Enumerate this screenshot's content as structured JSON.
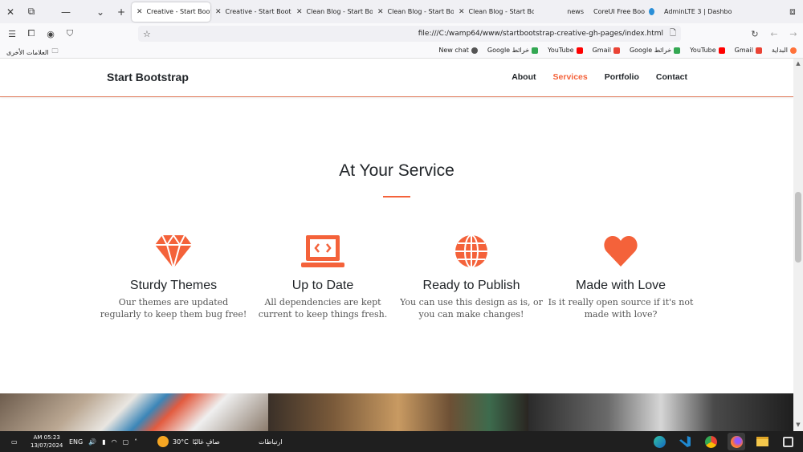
{
  "browser": {
    "tabs": [
      {
        "label": "Creative - Start Bootst",
        "active": true
      },
      {
        "label": "Creative - Start Bootst",
        "active": false
      },
      {
        "label": "Clean Blog - Start Boo",
        "active": false
      },
      {
        "label": "Clean Blog - Start Boo",
        "active": false
      },
      {
        "label": "Clean Blog - Start Boo",
        "active": false
      },
      {
        "label": "news",
        "active": false
      },
      {
        "label": "CoreUI Free Boo",
        "active": false
      },
      {
        "label": "AdminLTE 3 | Dashbo",
        "active": false
      }
    ],
    "url": "file:///C:/wamp64/www/startbootstrap-creative-gh-pages/index.html",
    "bookmarks_right": [
      "New chat",
      "Google خرائط",
      "YouTube",
      "Gmail",
      "Google خرائط",
      "YouTube",
      "Gmail",
      "البداية"
    ],
    "bookmarks_left": "العلامات الأخرى"
  },
  "site": {
    "brand": "Start Bootstrap",
    "nav": [
      "About",
      "Services",
      "Portfolio",
      "Contact"
    ],
    "active_nav": "Services",
    "section_title": "At Your Service",
    "accent": "#f4623a",
    "services": [
      {
        "icon": "gem-icon",
        "title": "Sturdy Themes",
        "text": "Our themes are updated regularly to keep them bug free!"
      },
      {
        "icon": "laptop-code-icon",
        "title": "Up to Date",
        "text": "All dependencies are kept current to keep things fresh."
      },
      {
        "icon": "globe-icon",
        "title": "Ready to Publish",
        "text": "You can use this design as is, or you can make changes!"
      },
      {
        "icon": "heart-icon",
        "title": "Made with Love",
        "text": "Is it really open source if it's not made with love?"
      }
    ]
  },
  "taskbar": {
    "time": "AM 05:23",
    "date": "13/07/2024",
    "lang": "ENG",
    "weather_temp": "30°C",
    "weather_text": "صافٍ غالبًا",
    "link_label": "ارتباطات"
  }
}
